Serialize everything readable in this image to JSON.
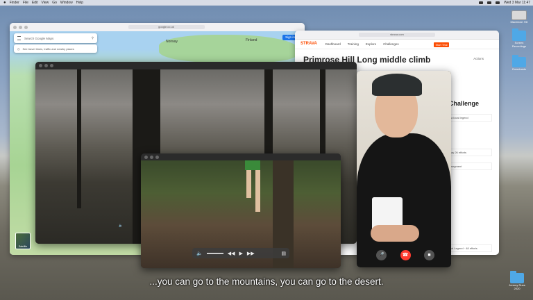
{
  "menubar": {
    "apple": "",
    "items": [
      "Finder",
      "File",
      "Edit",
      "View",
      "Go",
      "Window",
      "Help"
    ],
    "clock": "Wed 3 Mar 11:47"
  },
  "desktop_icons": [
    {
      "label": "Macintosh HD",
      "kind": "drive"
    },
    {
      "label": "Screen Recordings",
      "kind": "folder"
    },
    {
      "label": "Downloads",
      "kind": "folder"
    },
    {
      "label": "Jeremy Runs 2020",
      "kind": "folder"
    }
  ],
  "maps": {
    "url": "google.co.uk",
    "search_placeholder": "Search Google Maps",
    "subtext": "See travel times, traffic and nearby places",
    "sign_in": "Sign in",
    "labels": {
      "norway": "Norway",
      "finland": "Finland"
    },
    "satellite": "Satellite"
  },
  "strava": {
    "url": "strava.com",
    "logo": "STRAVA",
    "nav": [
      "Dashboard",
      "Training",
      "Explore",
      "Challenges"
    ],
    "start_trial": "Start Trial",
    "title": "Primrose Hill Long middle climb",
    "actions": "Actions",
    "challenge_heading": "Challenge",
    "card1": "a local legend",
    "card2": "ay 26 efforts",
    "card3": "segment",
    "card4": "al Legend · 48 efforts"
  },
  "video_controls": {
    "rewind": "◀◀",
    "play": "▶",
    "forward": "▶▶"
  },
  "subtitle": "...you can go to the mountains, you can go to the desert."
}
